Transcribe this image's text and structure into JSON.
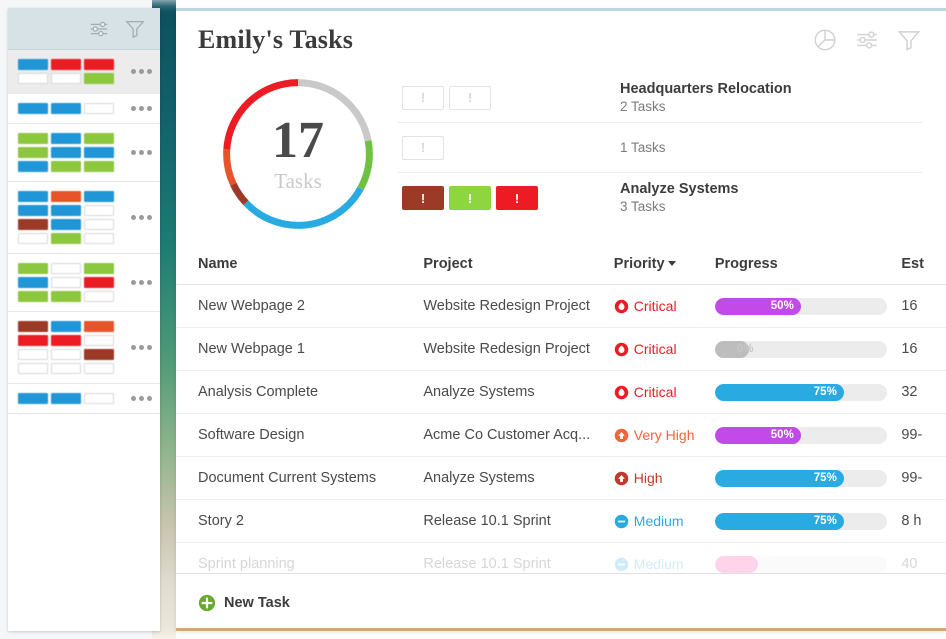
{
  "sidebar": {
    "toolbar_icons": [
      {
        "name": "sliders-icon"
      },
      {
        "name": "filter-icon"
      }
    ],
    "cards": [
      {
        "selected": true,
        "menu": "more-options",
        "rows": [
          [
            "#2196d6",
            "#ec1c24",
            "#ec1c24"
          ],
          [
            "empty",
            "empty",
            "#8dc63f"
          ]
        ]
      },
      {
        "selected": false,
        "menu": "more-options",
        "rows": [
          [
            "#2196d6",
            "#2196d6",
            "empty"
          ]
        ]
      },
      {
        "selected": false,
        "menu": "more-options",
        "rows": [
          [
            "#8dc63f",
            "#2196d6",
            "#8dc63f"
          ],
          [
            "#8dc63f",
            "#2196d6",
            "#2196d6"
          ],
          [
            "#2196d6",
            "#8dc63f",
            "#8dc63f"
          ]
        ]
      },
      {
        "selected": false,
        "menu": "more-options",
        "rows": [
          [
            "#2196d6",
            "#e8542a",
            "#2196d6"
          ],
          [
            "#2196d6",
            "#2196d6",
            "empty"
          ],
          [
            "#9c3a28",
            "#2196d6",
            "empty"
          ],
          [
            "empty",
            "#8dc63f",
            "empty"
          ]
        ]
      },
      {
        "selected": false,
        "menu": "more-options",
        "rows": [
          [
            "#8dc63f",
            "empty",
            "#8dc63f"
          ],
          [
            "#2196d6",
            "empty",
            "#ec1c24"
          ],
          [
            "#8dc63f",
            "#8dc63f",
            "empty"
          ]
        ]
      },
      {
        "selected": false,
        "menu": "more-options",
        "rows": [
          [
            "#9c3a28",
            "#2196d6",
            "#e8542a"
          ],
          [
            "#ec1c24",
            "#ec1c24",
            "empty"
          ],
          [
            "empty",
            "empty",
            "#9c3a28"
          ],
          [
            "empty",
            "empty",
            "empty"
          ]
        ]
      },
      {
        "selected": false,
        "menu": "more-options",
        "rows": [
          [
            "#2196d6",
            "#2196d6",
            "empty"
          ]
        ]
      }
    ]
  },
  "header": {
    "title": "Emily's Tasks",
    "icons": [
      {
        "name": "pie-chart-icon"
      },
      {
        "name": "sliders-icon"
      },
      {
        "name": "filter-icon"
      }
    ]
  },
  "donut": {
    "count": "17",
    "label": "Tasks",
    "segments": [
      {
        "color": "#c9c9c9",
        "value": 22
      },
      {
        "color": "#6fc144",
        "value": 11
      },
      {
        "color": "#29abe2",
        "value": 30
      },
      {
        "color": "#9c3a28",
        "value": 5
      },
      {
        "color": "#e8542a",
        "value": 8
      },
      {
        "color": "#ed1c24",
        "value": 24
      }
    ]
  },
  "summary": {
    "rows": [
      {
        "badges": [
          {
            "style": "ghost",
            "color": "#ffffff",
            "glyph": "!"
          },
          {
            "style": "ghost",
            "color": "#ffffff",
            "glyph": "!"
          }
        ],
        "title": "Headquarters Relocation",
        "subtitle": "2 Tasks"
      },
      {
        "badges": [
          {
            "style": "ghost",
            "color": "#ffffff",
            "glyph": "!"
          }
        ],
        "title": "",
        "subtitle": "1 Tasks"
      },
      {
        "badges": [
          {
            "style": "solid",
            "color": "#9c3a28",
            "glyph": "!"
          },
          {
            "style": "solid",
            "color": "#8dd63f",
            "glyph": "!"
          },
          {
            "style": "solid",
            "color": "#ed1c24",
            "glyph": "!"
          }
        ],
        "title": "Analyze Systems",
        "subtitle": "3 Tasks"
      }
    ]
  },
  "table": {
    "columns": [
      {
        "key": "name",
        "label": "Name",
        "sorted": false
      },
      {
        "key": "project",
        "label": "Project",
        "sorted": false
      },
      {
        "key": "priority",
        "label": "Priority",
        "sorted": true
      },
      {
        "key": "progress",
        "label": "Progress",
        "sorted": false
      },
      {
        "key": "estimate",
        "label": "Est",
        "sorted": false
      }
    ],
    "rows": [
      {
        "name": "New Webpage 2",
        "project": "Website Redesign Project",
        "priority": {
          "label": "Critical",
          "color": "#ed1c24",
          "icon": "critical-flame-icon"
        },
        "progress": {
          "percent": 50,
          "label": "50%",
          "color": "#c24ae8"
        },
        "estimate": "16",
        "faded": false
      },
      {
        "name": "New Webpage 1",
        "project": "Website Redesign Project",
        "priority": {
          "label": "Critical",
          "color": "#ed1c24",
          "icon": "critical-flame-icon"
        },
        "progress": {
          "percent": 0,
          "label": "0%",
          "color": "#bdbdbd"
        },
        "estimate": "16",
        "faded": false
      },
      {
        "name": "Analysis Complete",
        "project": "Analyze Systems",
        "priority": {
          "label": "Critical",
          "color": "#ed1c24",
          "icon": "critical-flame-icon"
        },
        "progress": {
          "percent": 75,
          "label": "75%",
          "color": "#29abe2"
        },
        "estimate": "32",
        "faded": false
      },
      {
        "name": "Software Design",
        "project": "Acme Co Customer Acq...",
        "priority": {
          "label": "Very High",
          "color": "#f4633a",
          "icon": "very-high-arrow-icon"
        },
        "progress": {
          "percent": 50,
          "label": "50%",
          "color": "#c24ae8"
        },
        "estimate": "99-",
        "faded": false
      },
      {
        "name": "Document Current Systems",
        "project": "Analyze Systems",
        "priority": {
          "label": "High",
          "color": "#c0392b",
          "icon": "high-arrow-icon"
        },
        "progress": {
          "percent": 75,
          "label": "75%",
          "color": "#29abe2"
        },
        "estimate": "99-",
        "faded": false
      },
      {
        "name": "Story 2",
        "project": "Release 10.1 Sprint",
        "priority": {
          "label": "Medium",
          "color": "#29abe2",
          "icon": "medium-minus-icon"
        },
        "progress": {
          "percent": 75,
          "label": "75%",
          "color": "#29abe2"
        },
        "estimate": "8 h",
        "faded": false
      },
      {
        "name": "Sprint planning",
        "project": "Release 10.1 Sprint",
        "priority": {
          "label": "Medium",
          "color": "#29abe2",
          "icon": "medium-minus-icon"
        },
        "progress": {
          "percent": 25,
          "label": "",
          "color": "#ff3ea5"
        },
        "estimate": "40",
        "faded": true
      }
    ]
  },
  "footer": {
    "new_task_label": "New Task",
    "new_task_icon": "plus-circle-icon",
    "accent_color": "#c08a4e"
  }
}
